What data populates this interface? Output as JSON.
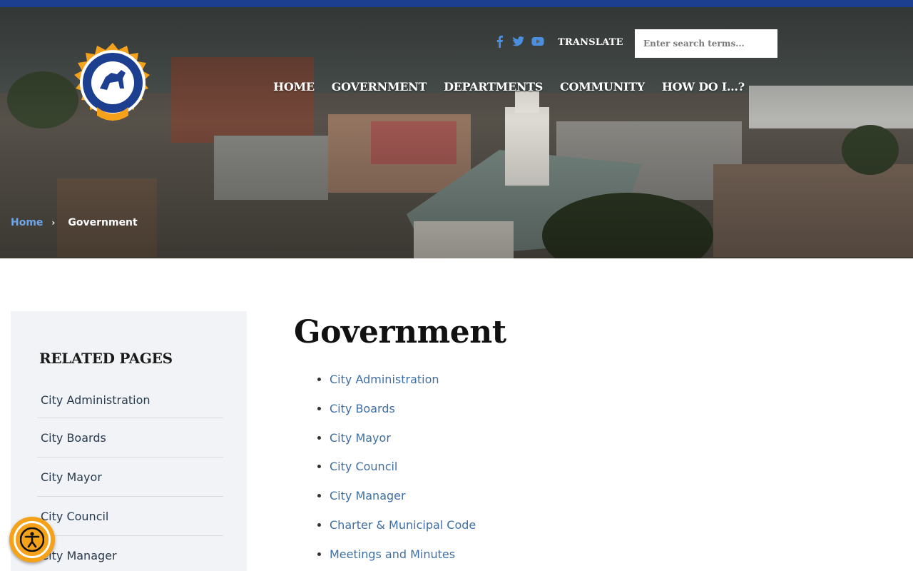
{
  "header": {
    "logo_alt": "Shelbyville Tennessee seal",
    "social": [
      {
        "icon": "facebook-icon"
      },
      {
        "icon": "twitter-icon"
      },
      {
        "icon": "youtube-icon"
      }
    ],
    "translate_label": "TRANSLATE",
    "search_placeholder": "Enter search terms...",
    "nav": [
      "HOME",
      "GOVERNMENT",
      "DEPARTMENTS",
      "COMMUNITY",
      "HOW DO I...?"
    ],
    "colors": {
      "top_bar": "#1d3f8f",
      "accent": "#f6a11a",
      "link": "#3d6fa6"
    }
  },
  "breadcrumb": {
    "home": "Home",
    "separator": "›",
    "current": "Government"
  },
  "sidebar": {
    "heading": "RELATED PAGES",
    "items": [
      "City Administration",
      "City Boards",
      "City Mayor",
      "City Council",
      "City Manager"
    ]
  },
  "main": {
    "title": "Government",
    "links": [
      "City Administration",
      "City Boards",
      "City Mayor",
      "City Council",
      "City Manager",
      "Charter & Municipal Code",
      "Meetings and Minutes"
    ]
  },
  "accessibility": {
    "icon": "accessibility-icon"
  }
}
